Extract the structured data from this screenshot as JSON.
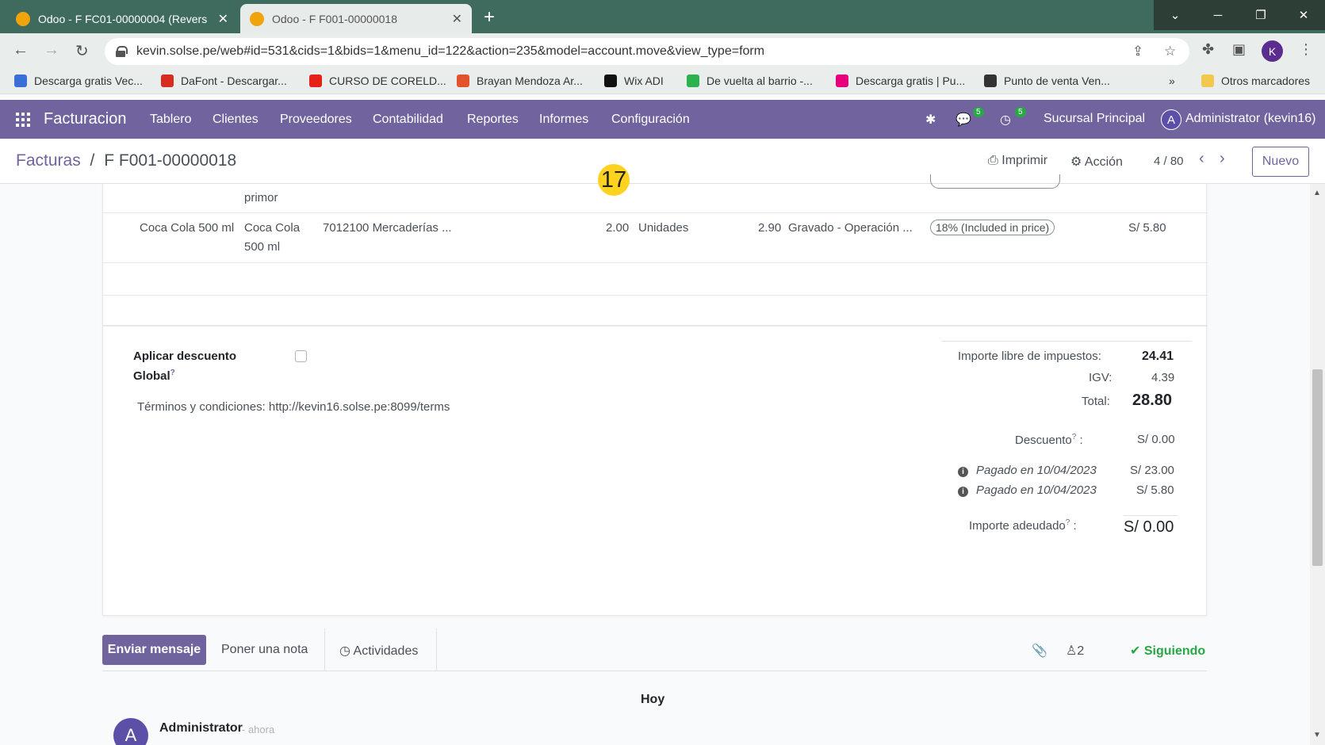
{
  "browser": {
    "tabs": [
      {
        "title": "Odoo - F FC01-00000004 (Revers",
        "active": true
      },
      {
        "title": "Odoo - F F001-00000018",
        "active": false
      }
    ],
    "url": "kevin.solse.pe/web#id=531&cids=1&bids=1&menu_id=122&action=235&model=account.move&view_type=form",
    "profile_initial": "K",
    "bookmarks": [
      {
        "label": "Descarga gratis Vec...",
        "color": "#3b6fd8"
      },
      {
        "label": "DaFont - Descargar...",
        "color": "#d62d20"
      },
      {
        "label": "CURSO DE CORELD...",
        "color": "#e62117"
      },
      {
        "label": "Brayan Mendoza Ar...",
        "color": "#e2532d"
      },
      {
        "label": "Wix ADI",
        "color": "#111111"
      },
      {
        "label": "De vuelta al barrio -...",
        "color": "#2bb24c"
      },
      {
        "label": "Descarga gratis | Pu...",
        "color": "#e6007e"
      },
      {
        "label": "Punto de venta Ven...",
        "color": "#333333"
      }
    ],
    "bookmarks_more": "»",
    "other_bookmarks": "Otros marcadores"
  },
  "app": {
    "brand": "Facturacion",
    "menu": [
      "Tablero",
      "Clientes",
      "Proveedores",
      "Contabilidad",
      "Reportes",
      "Informes",
      "Configuración"
    ],
    "messages_badge": "5",
    "activities_badge": "5",
    "branch": "Sucursal Principal",
    "user_initial": "A",
    "user": "Administrator (kevin16)"
  },
  "control_panel": {
    "breadcrumb_parent": "Facturas",
    "breadcrumb_sep": "/",
    "breadcrumb_current": "F F001-00000018",
    "print_label": "Imprimir",
    "action_label": "Acción",
    "pager": "4 / 80",
    "new_label": "Nuevo"
  },
  "step_badge": "17",
  "lines": {
    "partial_row_label": "primor",
    "row": {
      "product": "Coca Cola 500 ml",
      "label_line1": "Coca Cola",
      "label_line2": "500 ml",
      "account": "7012100 Mercaderías ...",
      "quantity": "2.00",
      "uom": "Unidades",
      "price": "2.90",
      "affectation": "Gravado - Operación ...",
      "tax": "18% (Included in price)",
      "subtotal": "S/ 5.80"
    }
  },
  "footer": {
    "discount_label_line1": "Aplicar descuento",
    "discount_label_line2": "Global",
    "help_mark": "?",
    "terms": "Términos y condiciones: http://kevin16.solse.pe:8099/terms",
    "untaxed_label": "Importe libre de impuestos:",
    "untaxed_value": "24.41",
    "igv_label": "IGV:",
    "igv_value": "4.39",
    "total_label": "Total:",
    "total_value": "28.80",
    "descuento_label": "Descuento",
    "descuento_value": "S/ 0.00",
    "payments": [
      {
        "label": "Pagado en 10/04/2023",
        "value": "S/ 23.00"
      },
      {
        "label": "Pagado en 10/04/2023",
        "value": "S/ 5.80"
      }
    ],
    "due_label": "Importe adeudado",
    "due_value": "S/ 0.00"
  },
  "chatter": {
    "send_label": "Enviar mensaje",
    "note_label": "Poner una nota",
    "activities_label": "Actividades",
    "followers_count": "2",
    "following_label": "Siguiendo",
    "date_separator": "Hoy",
    "author_initial": "A",
    "author": "Administrator",
    "time": "- ahora"
  }
}
